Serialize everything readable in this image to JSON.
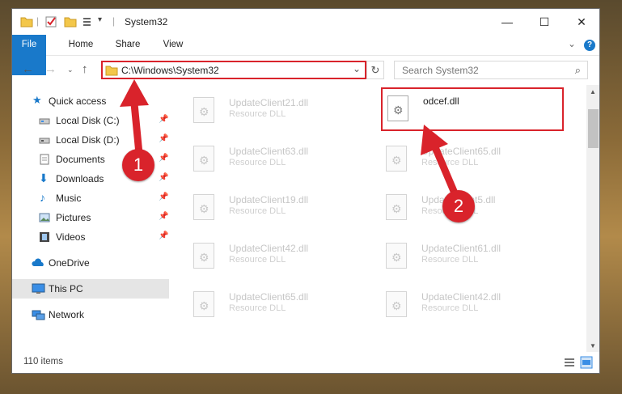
{
  "window": {
    "title": "System32",
    "quick_access_toolbar": [
      "folder-icon",
      "properties-check-icon",
      "new-folder-icon",
      "customize-icon"
    ],
    "controls": {
      "minimize": "—",
      "maximize": "☐",
      "close": "✕"
    }
  },
  "ribbon": {
    "tabs": [
      "File",
      "Home",
      "Share",
      "View"
    ],
    "expand_icon": "⌄",
    "help_icon": "?"
  },
  "address_bar": {
    "path": "C:\\Windows\\System32",
    "dropdown": "⌄",
    "refresh": "↻"
  },
  "search": {
    "placeholder": "Search System32",
    "icon": "⌕"
  },
  "nav_pane": {
    "items": [
      {
        "label": "Quick access",
        "icon": "star-icon",
        "pinned": false
      },
      {
        "label": "Local Disk (C:)",
        "icon": "drive-icon",
        "pinned": true
      },
      {
        "label": "Local Disk (D:)",
        "icon": "drive-icon",
        "pinned": true
      },
      {
        "label": "Documents",
        "icon": "documents-icon",
        "pinned": true
      },
      {
        "label": "Downloads",
        "icon": "download-icon",
        "pinned": true
      },
      {
        "label": "Music",
        "icon": "music-icon",
        "pinned": true
      },
      {
        "label": "Pictures",
        "icon": "pictures-icon",
        "pinned": true
      },
      {
        "label": "Videos",
        "icon": "videos-icon",
        "pinned": true
      },
      {
        "label": "OneDrive",
        "icon": "cloud-icon",
        "pinned": false
      },
      {
        "label": "This PC",
        "icon": "computer-icon",
        "pinned": false,
        "selected": true
      },
      {
        "label": "Network",
        "icon": "network-icon",
        "pinned": false
      }
    ]
  },
  "files": {
    "left_column": [
      {
        "name": "UpdateClient21.dll",
        "type": "Resource DLL"
      },
      {
        "name": "UpdateClient63.dll",
        "type": "Resource DLL"
      },
      {
        "name": "UpdateClient19.dll",
        "type": "Resource DLL"
      },
      {
        "name": "UpdateClient42.dll",
        "type": "Resource DLL"
      },
      {
        "name": "UpdateClient65.dll",
        "type": "Resource DLL"
      }
    ],
    "right_column": [
      {
        "name": "odcef.dll",
        "type": "",
        "highlighted": true
      },
      {
        "name": "UpdateClient65.dll",
        "type": "Resource DLL"
      },
      {
        "name": "UpdateClient5.dll",
        "type": "Resource DLL"
      },
      {
        "name": "UpdateClient61.dll",
        "type": "Resource DLL"
      },
      {
        "name": "UpdateClient42.dll",
        "type": "Resource DLL"
      }
    ]
  },
  "status_bar": {
    "count": "110 items"
  },
  "annotations": {
    "step1": "1",
    "step2": "2",
    "color": "#d9232b"
  }
}
